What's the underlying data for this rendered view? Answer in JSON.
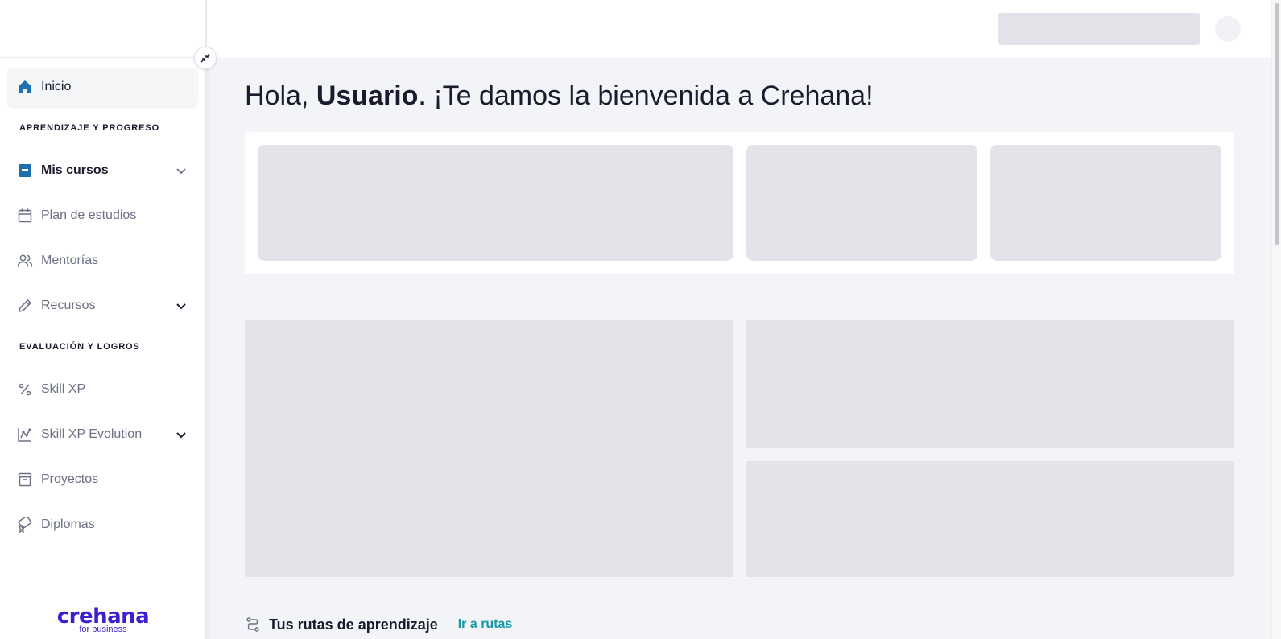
{
  "sidebar": {
    "inicio": "Inicio",
    "section_learning": "APRENDIZAJE Y PROGRESO",
    "mis_cursos": "Mis cursos",
    "plan_estudios": "Plan de estudios",
    "mentorias": "Mentorías",
    "recursos": "Recursos",
    "section_eval": "EVALUACIÓN Y LOGROS",
    "skill_xp": "Skill XP",
    "skill_xp_evolution": "Skill XP Evolution",
    "proyectos": "Proyectos",
    "diplomas": "Diplomas"
  },
  "brand": {
    "name": "crehana",
    "sub": "for business",
    "color": "#3b1fd1"
  },
  "main": {
    "greeting_prefix": "Hola, ",
    "greeting_name": "Usuario",
    "greeting_suffix": ". ¡Te damos la bienvenida a Crehana!",
    "routes_title": "Tus rutas de aprendizaje",
    "routes_link": "Ir a rutas"
  },
  "colors": {
    "accent": "#1a9aa8",
    "active_icon": "#1f6fb0",
    "skeleton": "#e2e4ea"
  },
  "icons": [
    "home-icon",
    "course-box-icon",
    "calendar-icon",
    "people-icon",
    "pencil-icon",
    "percent-icon",
    "chart-icon",
    "archive-icon",
    "diploma-icon",
    "route-icon",
    "collapse-icon",
    "chevron-down-icon"
  ]
}
